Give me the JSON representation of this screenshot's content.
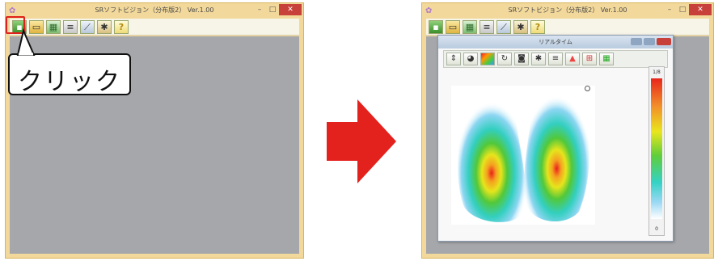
{
  "left_window": {
    "title": "SRソフトビジョン（分布版2） Ver.1.00",
    "toolbar_icons": [
      "start-icon",
      "folder-icon",
      "grid-icon",
      "list-icon",
      "tool-icon",
      "puzzle-icon",
      "help-icon"
    ],
    "help_glyph": "?",
    "controls": {
      "min": "–",
      "max": "□",
      "close": "✕"
    }
  },
  "callout": {
    "text": "クリック"
  },
  "right_window": {
    "title": "SRソフトビジョン（分布版2） Ver.1.00",
    "help_glyph": "?",
    "controls": {
      "min": "–",
      "max": "□",
      "close": "✕"
    }
  },
  "subwindow": {
    "title": "リアルタイム",
    "toolbar_icons": [
      "sort-icon",
      "color-circle-icon",
      "rainbow-icon",
      "rotate-icon",
      "camera-icon",
      "puzzle-icon",
      "list-icon",
      "mountain-icon",
      "bars-icon",
      "grid-icon"
    ],
    "scale": {
      "top_value": "1/8",
      "bottom_value": "0"
    }
  },
  "colors": {
    "window_border": "#f2d89a",
    "client_bg": "#a6a7ab",
    "highlight": "#e0201a",
    "arrow": "#e3211d"
  }
}
